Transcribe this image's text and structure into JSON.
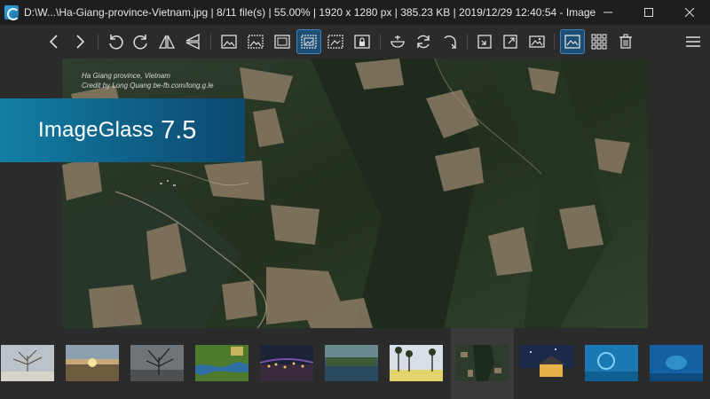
{
  "window": {
    "title": "D:\\W...\\Ha-Giang-province-Vietnam.jpg  |  8/11 file(s)  |  55.00%  |  1920 x 1280 px  |  385.23 KB  |  2019/12/29 12:40:54  -  Image...",
    "controls": [
      "minimize-icon",
      "maximize-icon",
      "close-icon"
    ]
  },
  "toolbar": {
    "buttons": [
      {
        "name": "previous-image-button",
        "icon": "chevron-left-icon"
      },
      {
        "name": "next-image-button",
        "icon": "chevron-right-icon"
      },
      {
        "name": "rotate-left-button",
        "icon": "rotate-left-icon"
      },
      {
        "name": "rotate-right-button",
        "icon": "rotate-right-icon"
      },
      {
        "name": "flip-horizontal-button",
        "icon": "flip-horizontal-icon"
      },
      {
        "name": "flip-vertical-button",
        "icon": "flip-vertical-icon"
      },
      {
        "name": "auto-zoom-button",
        "icon": "auto-zoom-icon"
      },
      {
        "name": "lock-zoom-button",
        "icon": "lock-zoom-icon"
      },
      {
        "name": "scale-to-width-button",
        "icon": "scale-width-icon"
      },
      {
        "name": "scale-to-fit-button",
        "icon": "scale-fit-icon",
        "active": true
      },
      {
        "name": "scale-to-fill-button",
        "icon": "scale-fill-icon"
      },
      {
        "name": "zoom-lock-button",
        "icon": "lock-icon"
      },
      {
        "name": "open-with-button",
        "icon": "bowl-icon"
      },
      {
        "name": "refresh-button",
        "icon": "refresh-icon"
      },
      {
        "name": "go-to-button",
        "icon": "goto-icon"
      },
      {
        "name": "window-fit-button",
        "icon": "window-fit-icon"
      },
      {
        "name": "fullscreen-button",
        "icon": "fullscreen-icon"
      },
      {
        "name": "slideshow-button",
        "icon": "slideshow-icon"
      },
      {
        "name": "thumbnail-bar-button",
        "icon": "thumbnail-bar-icon",
        "active": true
      },
      {
        "name": "gallery-grid-button",
        "icon": "grid-icon"
      },
      {
        "name": "delete-button",
        "icon": "trash-icon"
      },
      {
        "name": "main-menu-button",
        "icon": "hamburger-menu-icon"
      }
    ]
  },
  "viewer": {
    "caption_line1": "Ha Giang province, Vietnam",
    "caption_line2": "Credit by Long Quang be-fb.com/long.g.le"
  },
  "banner": {
    "name": "ImageGlass",
    "version": "7.5"
  },
  "thumbnails": {
    "count": 11,
    "selected_index": 7,
    "items": [
      {
        "name": "thumb-tree-winter"
      },
      {
        "name": "thumb-lake-sunset"
      },
      {
        "name": "thumb-bare-tree"
      },
      {
        "name": "thumb-river-aerial"
      },
      {
        "name": "thumb-city-night"
      },
      {
        "name": "thumb-forest-lake"
      },
      {
        "name": "thumb-palm-shore"
      },
      {
        "name": "thumb-ha-giang"
      },
      {
        "name": "thumb-night-house"
      },
      {
        "name": "thumb-ocean-blue-1"
      },
      {
        "name": "thumb-ocean-blue-2"
      }
    ]
  },
  "colors": {
    "window_bg": "#2b2b2b",
    "titlebar_bg": "#1e1e1e",
    "accent": "#1d4f75",
    "banner_start": "#127fa3",
    "banner_end": "#0c4a71"
  }
}
